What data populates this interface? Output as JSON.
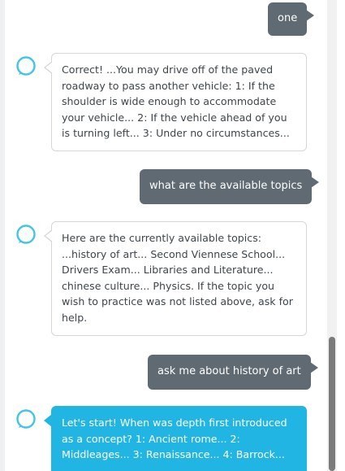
{
  "conversation": {
    "messages": [
      {
        "sender": "user",
        "text": "one"
      },
      {
        "sender": "alexa",
        "text": "Correct! ...You may drive off of the paved roadway to pass another vehicle: 1: If the shoulder is wide enough to accommodate your vehicle... 2: If the vehicle ahead of you is turning left... 3: Under no circumstances..."
      },
      {
        "sender": "user",
        "text": "what are the available topics"
      },
      {
        "sender": "alexa",
        "text": "Here are the currently available topics: ...history of art... Second Viennese School... Drivers Exam... Libraries and Literature... chinese culture... Physics. If the topic you wish to practice was not listed above, ask for help."
      },
      {
        "sender": "user",
        "text": "ask me about history of art"
      },
      {
        "sender": "alexa",
        "text": "Let's start! When was depth first introduced as a concept? 1: Ancient rome... 2: Middleages... 3: Renaissance... 4: Barrock..."
      }
    ]
  },
  "icons": {
    "alexa": "alexa-ring-icon"
  },
  "colors": {
    "user_bubble": "#5f6a72",
    "alexa_bubble_border": "#d3d7da",
    "alexa_active_bubble": "#20b5e3",
    "alexa_ring": "#3fc5ec",
    "scroll_thumb": "#7b7b7b"
  }
}
